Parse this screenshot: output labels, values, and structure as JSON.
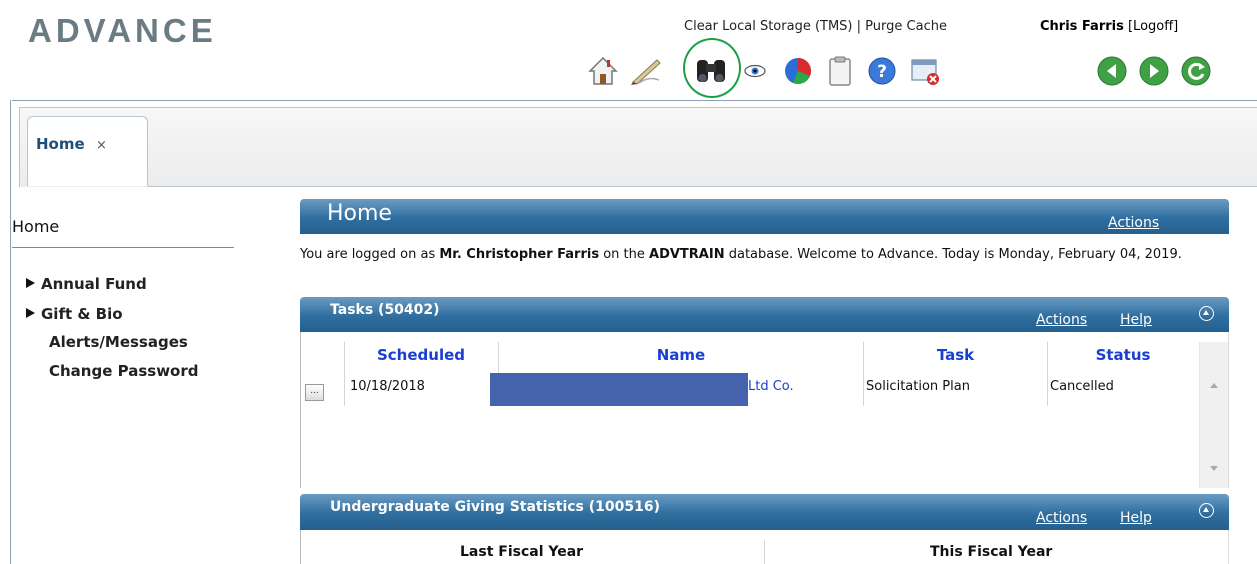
{
  "header": {
    "logo": "ADVANCE",
    "links": {
      "clear_storage": "Clear Local Storage (TMS)",
      "separator": " | ",
      "purge_cache": "Purge Cache"
    },
    "user_name": "Chris Farris",
    "logoff": "[Logoff]"
  },
  "toolbar": {
    "icons": [
      "home-icon",
      "pen-icon",
      "binoculars-icon",
      "eye-icon",
      "pie-chart-icon",
      "clipboard-icon",
      "help-icon",
      "window-close-icon",
      "back-icon",
      "forward-icon",
      "refresh-icon"
    ],
    "highlight_color": "#1aa046"
  },
  "tabs": [
    {
      "label": "Home",
      "close": "×"
    }
  ],
  "sidebar": {
    "title": "Home",
    "items": [
      {
        "label": "Annual Fund",
        "expandable": true
      },
      {
        "label": "Gift & Bio",
        "expandable": true
      },
      {
        "label": "Alerts/Messages",
        "expandable": false
      },
      {
        "label": "Change Password",
        "expandable": false
      }
    ]
  },
  "home_panel": {
    "title": "Home",
    "actions": "Actions",
    "welcome": {
      "prefix": "You are logged on as ",
      "user": "Mr. Christopher Farris",
      "middle": " on the ",
      "database": "ADVTRAIN",
      "suffix": " database. Welcome to Advance. Today is Monday, February 04, 2019."
    }
  },
  "tasks_panel": {
    "title": "Tasks (50402)",
    "actions": "Actions",
    "help": "Help",
    "columns": [
      "Scheduled",
      "Name",
      "Task",
      "Status"
    ],
    "rows": [
      {
        "menu": "...",
        "scheduled": "10/18/2018",
        "name_visible": "Ltd Co.",
        "task": "Solicitation Plan",
        "status": "Cancelled"
      }
    ]
  },
  "stats_panel": {
    "title": "Undergraduate Giving Statistics (100516)",
    "actions": "Actions",
    "help": "Help",
    "columns": [
      "Last Fiscal Year",
      "This Fiscal Year"
    ]
  },
  "colors": {
    "bar_blue": "#2f6e9f",
    "link_blue": "#1a3fd0",
    "redaction": "#4563ad"
  }
}
